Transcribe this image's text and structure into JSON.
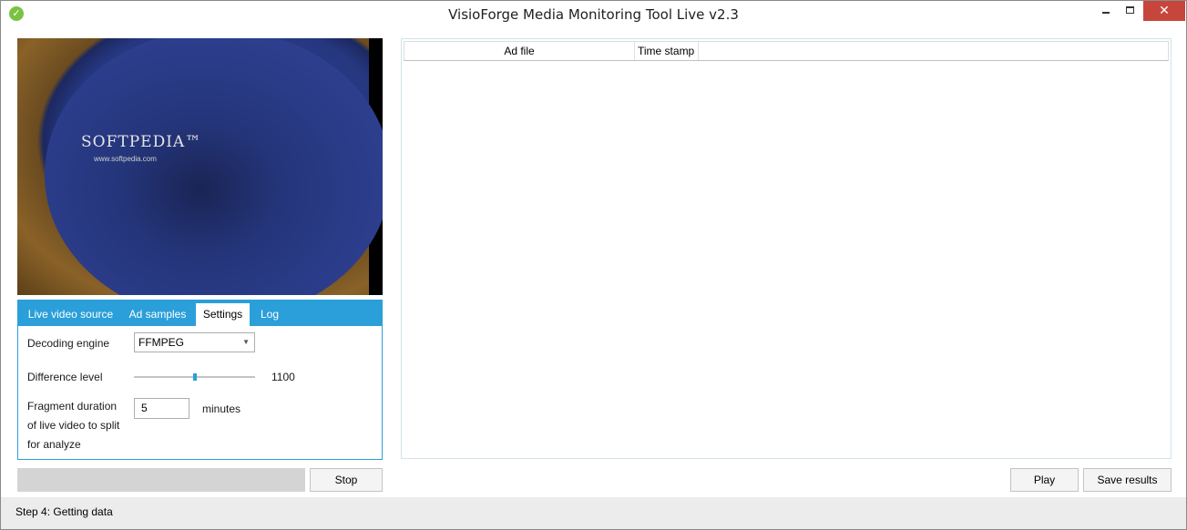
{
  "window": {
    "title": "VisioForge Media Monitoring Tool Live v2.3",
    "close_glyph": "✕"
  },
  "video": {
    "brand": "SOFTPEDIA™",
    "url": "www.softpedia.com"
  },
  "tabs": [
    {
      "label": "Live video source",
      "active": false
    },
    {
      "label": "Ad samples",
      "active": false
    },
    {
      "label": "Settings",
      "active": true
    },
    {
      "label": "Log",
      "active": false
    }
  ],
  "settings": {
    "decoding_engine_label": "Decoding engine",
    "decoding_engine_value": "FFMPEG",
    "difference_level_label": "Difference level",
    "difference_level_value": "1100",
    "fragment_label_line1": "Fragment duration",
    "fragment_label_line2": "of live video to split",
    "fragment_label_line3": "for analyze",
    "fragment_value": "5",
    "fragment_unit": "minutes"
  },
  "progress": {
    "fraction": 0
  },
  "buttons": {
    "stop": "Stop",
    "play": "Play",
    "save_results": "Save results"
  },
  "results_table": {
    "columns": [
      "Ad file",
      "Time stamp"
    ],
    "rows": []
  },
  "status": {
    "text": "Step 4: Getting data"
  },
  "colors": {
    "accent": "#2b9fd9",
    "close_button": "#c7463b"
  }
}
